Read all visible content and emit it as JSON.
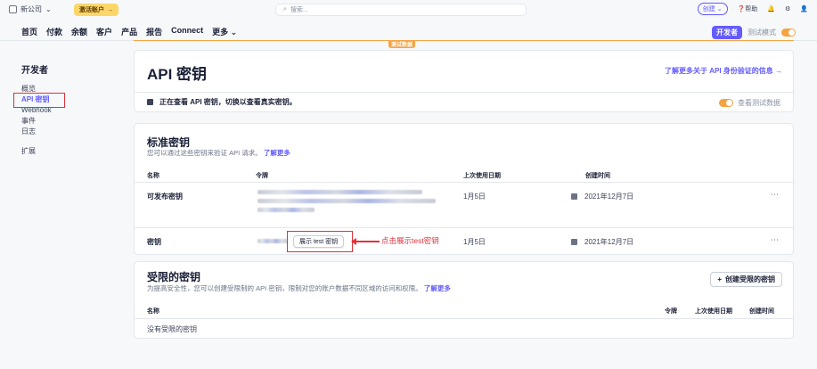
{
  "topbar": {
    "account": "新公司",
    "activate": "激活账户",
    "search_placeholder": "搜索...",
    "create": "创建",
    "help": "帮助"
  },
  "nav": {
    "items": [
      "首页",
      "付款",
      "余额",
      "客户",
      "产品",
      "报告",
      "Connect",
      "更多"
    ],
    "developer": "开发者",
    "test_mode": "测试模式",
    "test_badge": "测试数据"
  },
  "sidebar": {
    "title": "开发者",
    "items": [
      "概览",
      "API 密钥",
      "Webhook",
      "事件",
      "日志"
    ],
    "extensions": "扩展"
  },
  "api_card": {
    "title": "API 密钥",
    "learn_more": "了解更多关于 API 身份验证的信息 →",
    "info": "正在查看 API 密钥，切换以查看真实密钥。",
    "view_test": "查看测试数据"
  },
  "standard": {
    "title": "标准密钥",
    "subtitle": "您可以通过这些密钥来验证 API 请求。",
    "learn": "了解更多",
    "headers": [
      "名称",
      "令牌",
      "上次使用日期",
      "创建时间"
    ],
    "rows": [
      {
        "name": "可发布密钥",
        "last_used": "1月5日",
        "created": "2021年12月7日"
      },
      {
        "name": "密钥",
        "last_used": "1月5日",
        "created": "2021年12月7日"
      }
    ],
    "reveal": "展示 test 密钥",
    "annotation": "点击展示test密钥"
  },
  "restricted": {
    "title": "受限的密钥",
    "subtitle": "为提高安全性，您可以创建受限制的 API 密钥，限制对您的账户数据不同区域的访问和权限。",
    "learn": "了解更多",
    "create": "创建受限的密钥",
    "headers": [
      "名称",
      "令牌",
      "上次使用日期",
      "创建时间"
    ],
    "empty": "没有受限的密钥"
  },
  "colors": {
    "accent": "#635bff",
    "test": "#f5a341",
    "annotation": "#e0323c"
  }
}
